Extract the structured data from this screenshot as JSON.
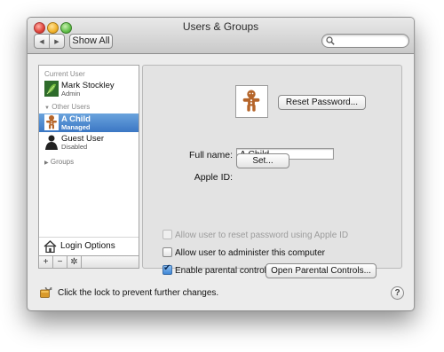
{
  "window": {
    "title": "Users & Groups"
  },
  "toolbar": {
    "show_all_label": "Show All",
    "search_placeholder": ""
  },
  "sidebar": {
    "current_user_header": "Current User",
    "current_user": {
      "name": "Mark Stockley",
      "role": "Admin"
    },
    "other_users_header": "Other Users",
    "users": [
      {
        "name": "A Child",
        "role": "Managed",
        "selected": true
      },
      {
        "name": "Guest User",
        "role": "Disabled",
        "selected": false
      }
    ],
    "groups_label": "Groups",
    "login_options_label": "Login Options",
    "bottom_buttons": [
      "+",
      "−",
      "✲"
    ]
  },
  "detail": {
    "reset_password_label": "Reset Password...",
    "full_name_label": "Full name:",
    "full_name_value": "A Child",
    "apple_id_label": "Apple ID:",
    "apple_id_button": "Set...",
    "checkboxes": [
      {
        "label": "Allow user to reset password using Apple ID",
        "checked": false,
        "enabled": false
      },
      {
        "label": "Allow user to administer this computer",
        "checked": false,
        "enabled": true
      },
      {
        "label": "Enable parental controls",
        "checked": true,
        "enabled": true
      }
    ],
    "open_parental_controls_label": "Open Parental Controls..."
  },
  "footer": {
    "lock_text": "Click the lock to prevent further changes.",
    "help_label": "?"
  }
}
